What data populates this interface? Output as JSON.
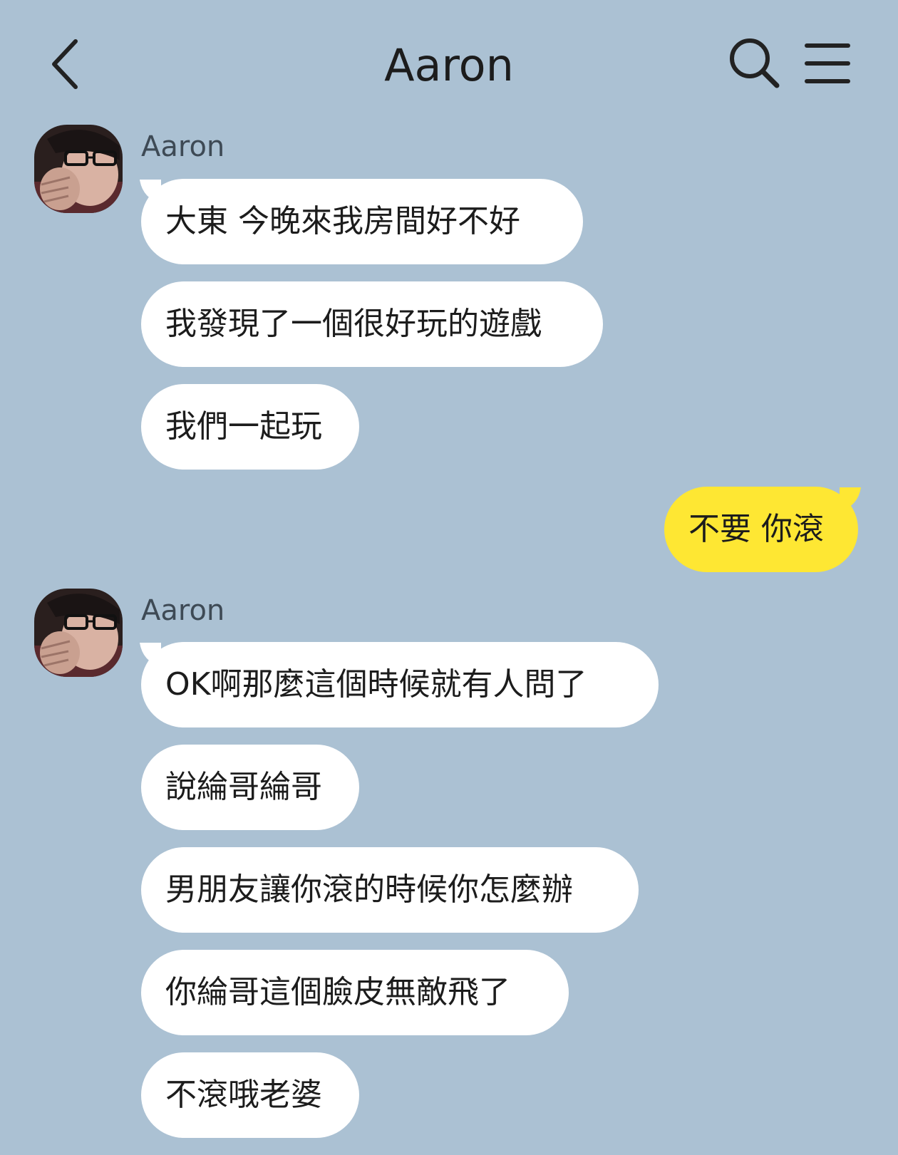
{
  "header": {
    "title": "Aaron",
    "back_icon": "chevron-left-icon",
    "search_icon": "search-icon",
    "menu_icon": "hamburger-menu-icon"
  },
  "colors": {
    "background": "#abc1d3",
    "incoming_bubble": "#ffffff",
    "outgoing_bubble": "#fee733",
    "text": "#1c1c1c"
  },
  "groups": [
    {
      "sender": "Aaron",
      "direction": "incoming",
      "messages": [
        "大東 今晚來我房間好不好",
        "我發現了一個很好玩的遊戲",
        "我們一起玩"
      ]
    },
    {
      "sender": "me",
      "direction": "outgoing",
      "messages": [
        "不要 你滾"
      ]
    },
    {
      "sender": "Aaron",
      "direction": "incoming",
      "messages": [
        "OK啊那麼這個時候就有人問了",
        "說綸哥綸哥",
        "男朋友讓你滾的時候你怎麼辦",
        "你綸哥這個臉皮無敵飛了",
        "不滾哦老婆"
      ]
    }
  ]
}
